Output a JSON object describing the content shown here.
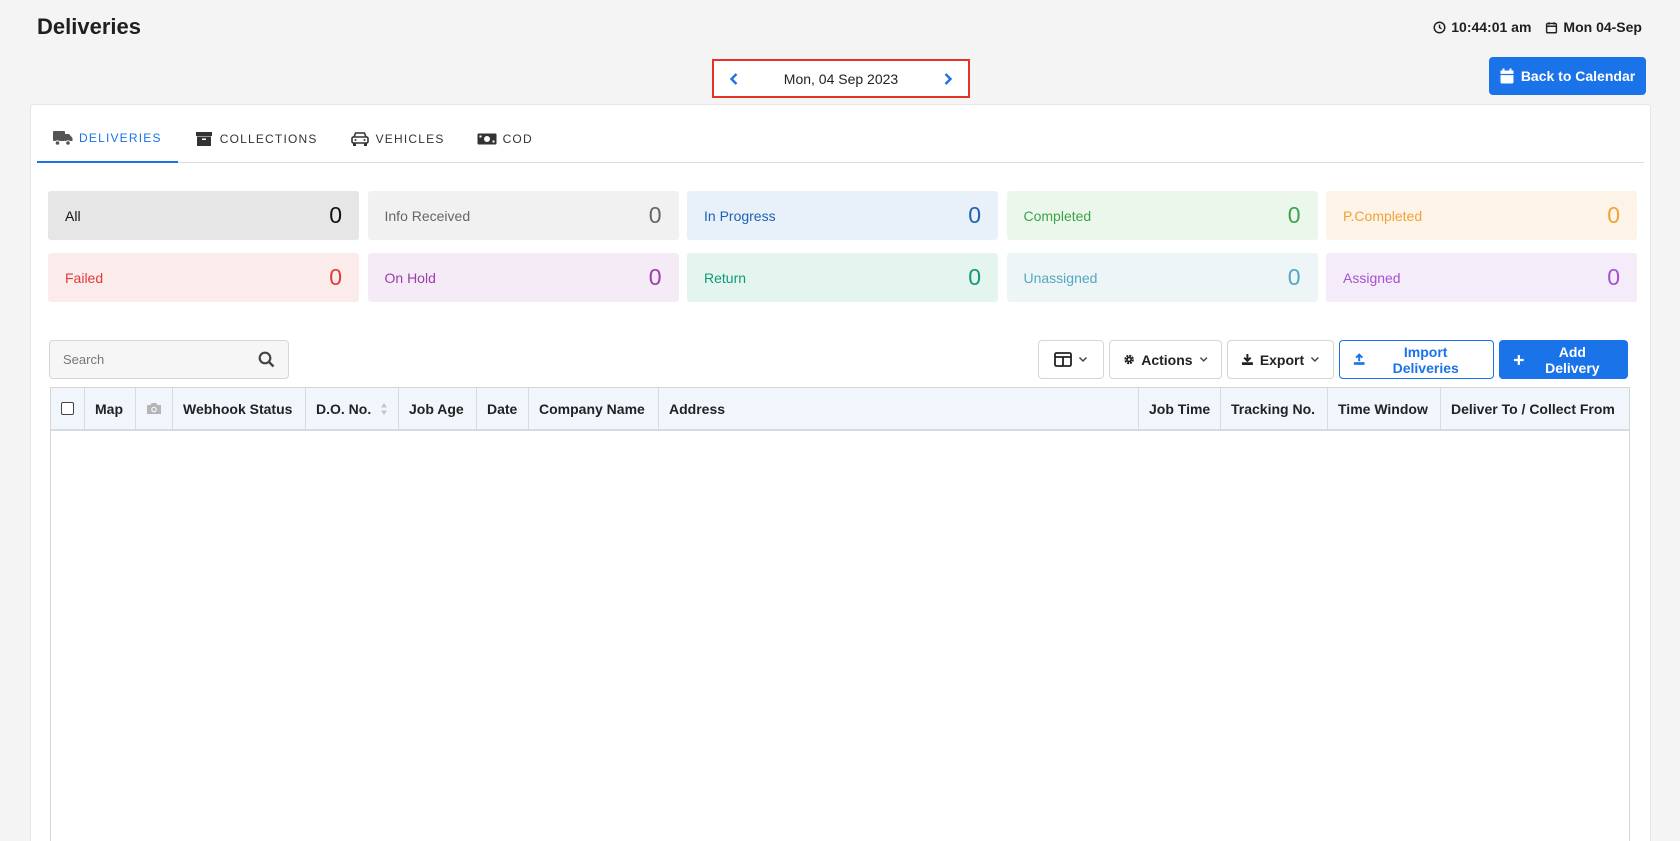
{
  "header": {
    "title": "Deliveries",
    "time": "10:44:01 am",
    "date": "Mon 04-Sep"
  },
  "date_nav": {
    "label": "Mon, 04 Sep 2023"
  },
  "back_button": {
    "label": "Back to Calendar"
  },
  "tabs": [
    {
      "label": "DELIVERIES",
      "icon": "truck-icon",
      "active": true
    },
    {
      "label": "COLLECTIONS",
      "icon": "archive-box-icon",
      "active": false
    },
    {
      "label": "VEHICLES",
      "icon": "car-icon",
      "active": false
    },
    {
      "label": "COD",
      "icon": "money-bill-icon",
      "active": false
    }
  ],
  "stats": [
    {
      "label": "All",
      "count": "0",
      "bg": "#e6e6e6",
      "fg": "#111111"
    },
    {
      "label": "Info Received",
      "count": "0",
      "bg": "#f1f1f1",
      "fg": "#666666"
    },
    {
      "label": "In Progress",
      "count": "0",
      "bg": "#e8f0fa",
      "fg": "#1e62b0"
    },
    {
      "label": "Completed",
      "count": "0",
      "bg": "#ecf7ec",
      "fg": "#3aa44a"
    },
    {
      "label": "P.Completed",
      "count": "0",
      "bg": "#fdf3e7",
      "fg": "#f0a33a"
    },
    {
      "label": "Failed",
      "count": "0",
      "bg": "#fcebeb",
      "fg": "#e03b3b"
    },
    {
      "label": "On Hold",
      "count": "0",
      "bg": "#f5ebf6",
      "fg": "#9a3ea8"
    },
    {
      "label": "Return",
      "count": "0",
      "bg": "#e4f5ef",
      "fg": "#109a78"
    },
    {
      "label": "Unassigned",
      "count": "0",
      "bg": "#eef5f7",
      "fg": "#52a8c2"
    },
    {
      "label": "Assigned",
      "count": "0",
      "bg": "#f5ecf9",
      "fg": "#a552d2"
    }
  ],
  "toolbar": {
    "search_placeholder": "Search",
    "actions_label": "Actions",
    "export_label": "Export",
    "import_label": "Import Deliveries",
    "add_label": "Add Delivery"
  },
  "table": {
    "columns": [
      "Map",
      "Webhook Status",
      "D.O. No.",
      "Job Age",
      "Date",
      "Company Name",
      "Address",
      "Job Time",
      "Tracking No.",
      "Time Window",
      "Deliver To / Collect From"
    ]
  },
  "colors": {
    "accent": "#1a73e8",
    "highlight": "#e53426"
  }
}
